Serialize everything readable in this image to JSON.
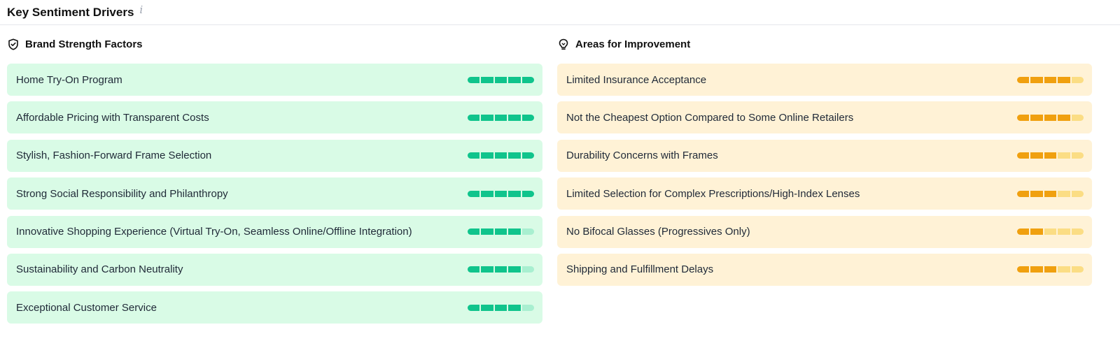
{
  "header": {
    "title": "Key Sentiment Drivers",
    "info_glyph": "i"
  },
  "colors": {
    "strength_fill": "#10c48c",
    "strength_empty": "#a8efd0",
    "improve_fill": "#f0a00f",
    "improve_empty": "#fbdd84"
  },
  "strengths": {
    "title": "Brand Strength Factors",
    "icon": "shield-check-icon",
    "items": [
      {
        "label": "Home Try-On Program",
        "score": 5
      },
      {
        "label": "Affordable Pricing with Transparent Costs",
        "score": 5
      },
      {
        "label": "Stylish, Fashion-Forward Frame Selection",
        "score": 5
      },
      {
        "label": "Strong Social Responsibility and Philanthropy",
        "score": 5
      },
      {
        "label": "Innovative Shopping Experience (Virtual Try-On, Seamless Online/Offline Integration)",
        "score": 4
      },
      {
        "label": "Sustainability and Carbon Neutrality",
        "score": 4
      },
      {
        "label": "Exceptional Customer Service",
        "score": 4
      }
    ]
  },
  "improvements": {
    "title": "Areas for Improvement",
    "icon": "lightbulb-icon",
    "items": [
      {
        "label": "Limited Insurance Acceptance",
        "score": 4
      },
      {
        "label": "Not the Cheapest Option Compared to Some Online Retailers",
        "score": 4
      },
      {
        "label": "Durability Concerns with Frames",
        "score": 3
      },
      {
        "label": "Limited Selection for Complex Prescriptions/High-Index Lenses",
        "score": 3
      },
      {
        "label": "No Bifocal Glasses (Progressives Only)",
        "score": 2
      },
      {
        "label": "Shipping and Fulfillment Delays",
        "score": 3
      }
    ]
  },
  "scale_max": 5
}
